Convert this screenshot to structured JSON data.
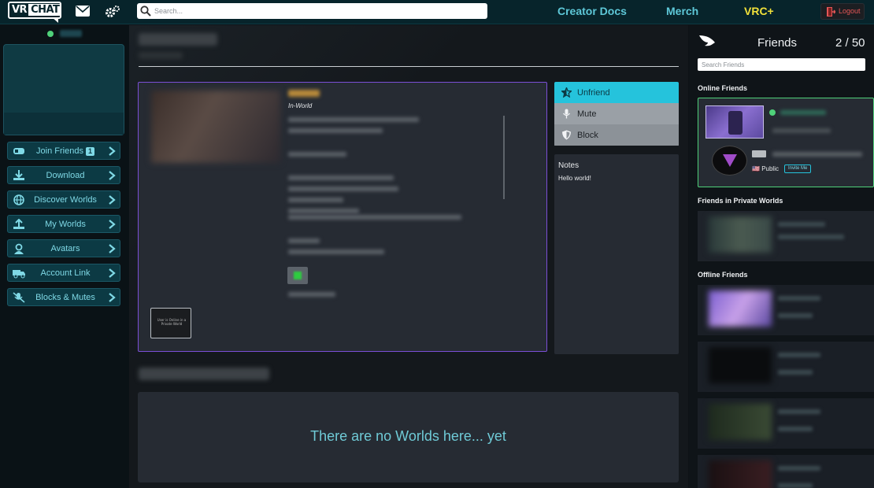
{
  "topbar": {
    "logo": {
      "left": "VR",
      "right": "CHAT"
    },
    "search_placeholder": "Search...",
    "links": [
      "Creator Docs",
      "Merch",
      "VRC+"
    ],
    "logout_label": "Logout"
  },
  "sidebar": {
    "items": [
      {
        "label": "Join Friends",
        "badge": "1",
        "icon": "join-friends-icon"
      },
      {
        "label": "Download",
        "icon": "download-icon"
      },
      {
        "label": "Discover Worlds",
        "icon": "globe-icon"
      },
      {
        "label": "My Worlds",
        "icon": "upload-icon"
      },
      {
        "label": "Avatars",
        "icon": "avatar-icon"
      },
      {
        "label": "Account Link",
        "icon": "truck-icon"
      },
      {
        "label": "Blocks & Mutes",
        "icon": "mute-icon"
      }
    ]
  },
  "profile": {
    "location_label": "In-World",
    "small_thumb_text": "User is Online in a Private World"
  },
  "actions": {
    "unfriend": "Unfriend",
    "mute": "Mute",
    "block": "Block"
  },
  "notes": {
    "heading": "Notes",
    "body": "Hello world!"
  },
  "worlds": {
    "empty_message": "There are no Worlds here... yet"
  },
  "friends": {
    "title": "Friends",
    "count": "2 / 50",
    "search_placeholder": "Search Friends",
    "sections": {
      "online": "Online Friends",
      "private": "Friends in Private Worlds",
      "offline": "Offline Friends"
    },
    "online_entry": {
      "instance_type": "Public",
      "invite_label": "Invite Me"
    }
  },
  "colors": {
    "accent": "#25c3dc",
    "online": "#4fd17a",
    "panel_border": "#7b4fd6",
    "vrc_plus": "#f2e13a",
    "logout": "#e45656"
  }
}
